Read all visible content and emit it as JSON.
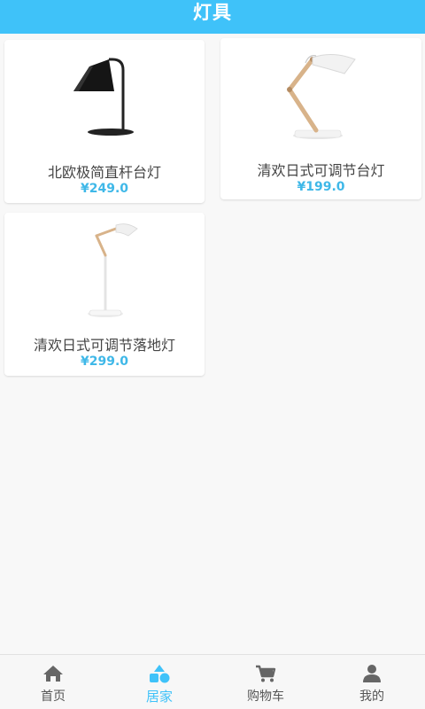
{
  "header": {
    "title": "灯具"
  },
  "products": [
    {
      "name": "北欧极简直杆台灯",
      "price": "¥249.0",
      "image": "black-desk-lamp"
    },
    {
      "name": "清欢日式可调节台灯",
      "price": "¥199.0",
      "image": "wooden-adjustable-desk-lamp"
    },
    {
      "name": "清欢日式可调节落地灯",
      "price": "¥299.0",
      "image": "wooden-floor-lamp"
    }
  ],
  "tabbar": {
    "items": [
      {
        "label": "首页",
        "icon": "home-icon"
      },
      {
        "label": "居家",
        "icon": "shapes-icon",
        "active": true
      },
      {
        "label": "购物车",
        "icon": "cart-icon"
      },
      {
        "label": "我的",
        "icon": "user-icon"
      }
    ]
  },
  "colors": {
    "accent": "#3fc2f9",
    "price": "#3fb8e8",
    "background": "#f8f8f8"
  }
}
